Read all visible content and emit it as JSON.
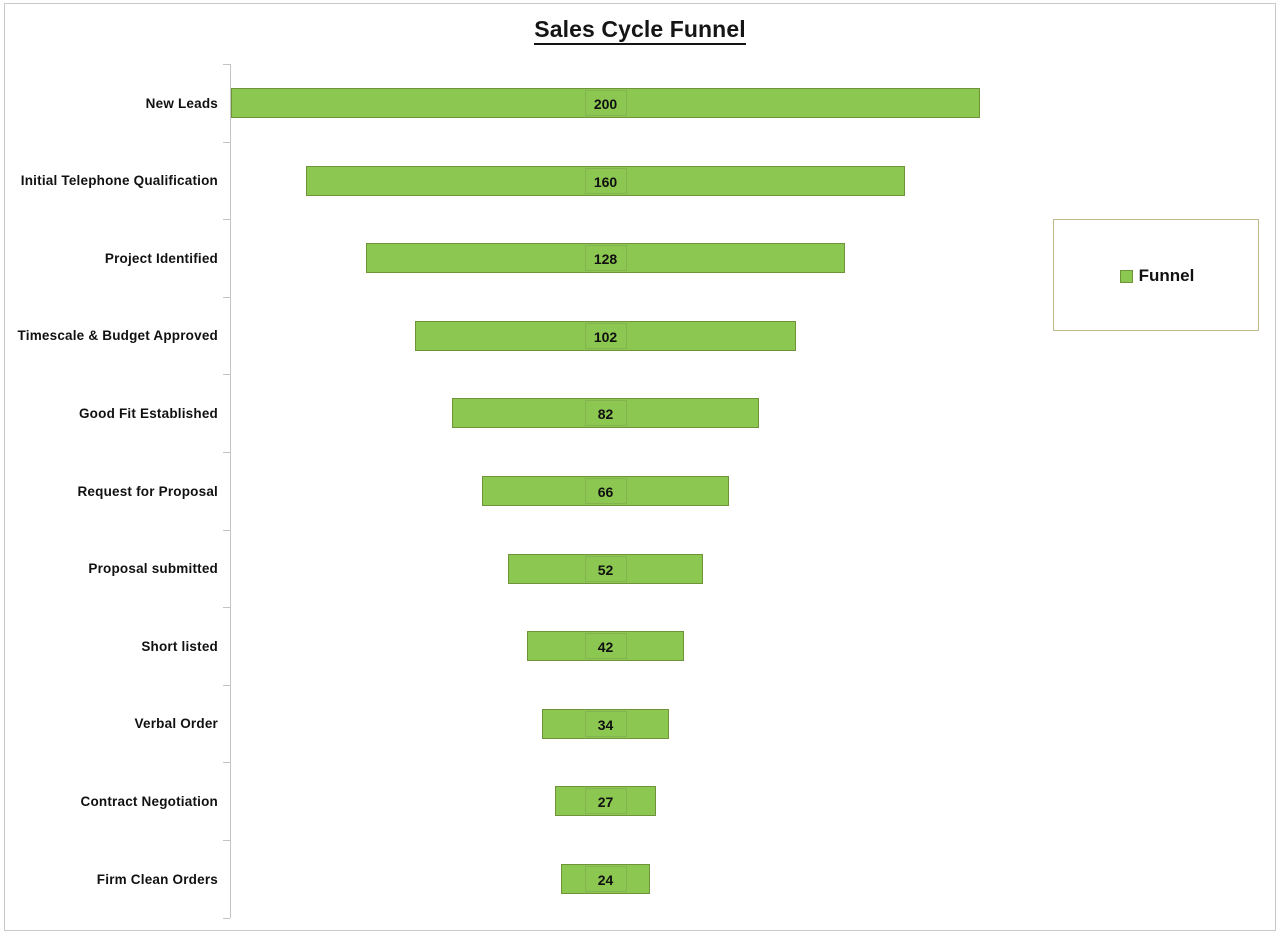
{
  "chart": {
    "title": "Sales Cycle Funnel",
    "legend": {
      "entries": [
        {
          "label": "Funnel",
          "color": "#8cc751"
        }
      ],
      "position": "right"
    }
  },
  "chart_data": {
    "type": "bar",
    "orientation": "horizontal",
    "subtype": "funnel",
    "title": "Sales Cycle Funnel",
    "xlabel": "",
    "ylabel": "",
    "categories": [
      "New Leads",
      "Initial Telephone Qualification",
      "Project Identified",
      "Timescale & Budget Approved",
      "Good Fit Established",
      "Request for Proposal",
      "Proposal submitted",
      "Short listed",
      "Verbal Order",
      "Contract Negotiation",
      "Firm Clean Orders"
    ],
    "values": [
      200,
      160,
      128,
      102,
      82,
      66,
      52,
      42,
      34,
      27,
      24
    ],
    "series": [
      {
        "name": "Funnel",
        "color": "#8cc751",
        "values": [
          200,
          160,
          128,
          102,
          82,
          66,
          52,
          42,
          34,
          27,
          24
        ]
      }
    ],
    "xlim": [
      0,
      200
    ],
    "grid": false,
    "data_labels": true
  },
  "colors": {
    "bar_fill": "#8cc751",
    "bar_border": "#6f9338",
    "axis": "#c4c4c4",
    "frame": "#c9c9c9",
    "legend_border": "#bdb98b",
    "text": "#111111"
  }
}
